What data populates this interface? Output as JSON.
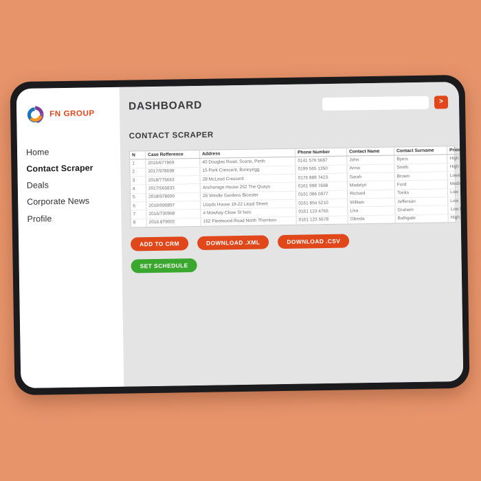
{
  "theme": {
    "background_color": "#e7946b",
    "device_frame_color": "#1b1b1d",
    "screen_background": "#e4e4e4",
    "sidebar_background": "#ffffff",
    "accent_orange": "#e0481b",
    "accent_green": "#3aa72e",
    "brand_purple": "#7b3f98",
    "brand_blue": "#1b75bb",
    "brand_orange": "#f7941e"
  },
  "brand": {
    "name": "FN GROUP",
    "logo_icon": "circular-swirl-logo-icon"
  },
  "sidebar": {
    "items": [
      {
        "label": "Home",
        "active": false
      },
      {
        "label": "Contact Scraper",
        "active": true
      },
      {
        "label": "Deals",
        "active": false
      },
      {
        "label": "Corporate News",
        "active": false
      },
      {
        "label": "Profile",
        "active": false
      }
    ]
  },
  "header": {
    "title": "DASHBOARD",
    "search": {
      "value": "",
      "placeholder": "",
      "submit_label": ">",
      "submit_icon": "chevron-right-icon"
    }
  },
  "main": {
    "section_title": "CONTACT SCRAPER",
    "table": {
      "columns": [
        "N",
        "Case Refference",
        "Address",
        "Phone Number",
        "Contact Name",
        "Contact Surname",
        "Priority"
      ],
      "rows": [
        [
          "1",
          "2016/677869",
          "40 Douglas Road, Scone, Perth",
          "0141 576 5687",
          "John",
          "Byers",
          "High"
        ],
        [
          "2",
          "2017/978698",
          "15 Park Crescent, Bonnyrigg",
          "0199 565 1350",
          "Anna",
          "Smith",
          "High"
        ],
        [
          "3",
          "2018/775663",
          "28 McLeod Crescent",
          "0176 888 7423",
          "Sarah",
          "Brown",
          "Lowe"
        ],
        [
          "4",
          "2017/565833",
          "Anchorage House 252 The Quays",
          "0161 998 7698",
          "Madelyn",
          "Ford",
          "Medium"
        ],
        [
          "5",
          "2018/978600",
          "26 Windle Gardens Bicester",
          "0161 086 0977",
          "Richard",
          "Tonks",
          "Low"
        ],
        [
          "6",
          "2019/090897",
          "Lloyds House 18-22 Lloyd Street",
          "0161 854 5210",
          "William",
          "Jefferson",
          "Low"
        ],
        [
          "7",
          "2016/730968",
          "4 Mowhay Close St Ives",
          "0161 123 4765",
          "Lisa",
          "Graham",
          "Low Medium"
        ],
        [
          "8",
          "2016.879002",
          "162 Fleetwood Road North Thornton-",
          "0161 123 5678",
          "Glenda",
          "Bathgate",
          "High"
        ]
      ]
    },
    "actions": [
      {
        "label": "ADD TO CRM",
        "style": "orange",
        "name": "add-to-crm-button"
      },
      {
        "label": "DOWNLOAD .XML",
        "style": "orange",
        "name": "download-xml-button"
      },
      {
        "label": "DOWNLOAD .CSV",
        "style": "orange",
        "name": "download-csv-button"
      }
    ],
    "schedule_action": {
      "label": "SET SCHEDULE",
      "style": "green",
      "name": "set-schedule-button"
    }
  }
}
